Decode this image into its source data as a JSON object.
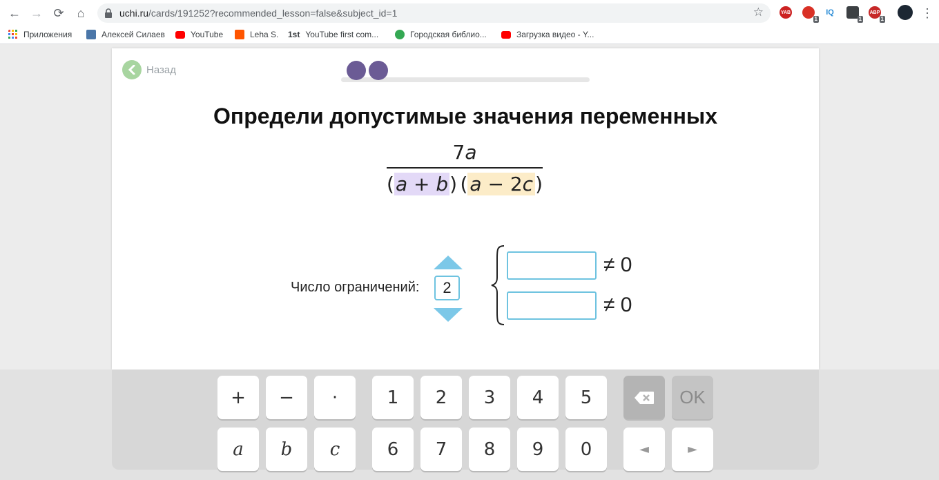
{
  "browser": {
    "url_host": "uchi.ru",
    "url_path": "/cards/191252?recommended_lesson=false&subject_id=1",
    "nav": {
      "back": "←",
      "forward": "→",
      "reload": "⟳",
      "home": "⌂"
    },
    "star": "☆",
    "menu": "⋮",
    "extensions": [
      {
        "label": "YAB",
        "color": "#cc2222",
        "badge": ""
      },
      {
        "label": "",
        "color": "#d93025",
        "badge": "1"
      },
      {
        "label": "IQ",
        "color": "#ffffff",
        "badge": ""
      },
      {
        "label": "",
        "color": "#3c4043",
        "badge": "1"
      },
      {
        "label": "ABP",
        "color": "#c62828",
        "badge": "1"
      }
    ]
  },
  "bookmarks": [
    {
      "label": "Приложения",
      "icon": "apps-grid-icon",
      "color": "#ea4335"
    },
    {
      "label": "Алексей Силаев",
      "icon": "vk-icon",
      "color": "#4a76a8"
    },
    {
      "label": "YouTube",
      "icon": "youtube-icon",
      "color": "#ff0000"
    },
    {
      "label": "Leha S.",
      "icon": "soundcloud-icon",
      "color": "#ff5500"
    },
    {
      "label": "YouTube first com...",
      "icon": "1st-icon",
      "color": "#ffffff",
      "prefix": "1st"
    },
    {
      "label": "Городская библио...",
      "icon": "library-icon",
      "color": "#34a853"
    },
    {
      "label": "Загрузка видео - Y...",
      "icon": "youtube-icon",
      "color": "#ff0000"
    }
  ],
  "page": {
    "back_label": "Назад",
    "progress_steps": 2,
    "title": "Определи допустимые значения переменных",
    "numerator": "7",
    "numerator_var": "a",
    "denominator": {
      "open1": "(",
      "f1_a": "a",
      "f1_op": " + ",
      "f1_b": "b",
      "close1": ")",
      "open2": "(",
      "f2_a": "a",
      "f2_op": " − 2",
      "f2_b": "c",
      "close2": ")"
    },
    "count_label": "Число ограничений:",
    "count_value": "2",
    "conditions": [
      {
        "value": "",
        "suffix": "≠ 0"
      },
      {
        "value": "",
        "suffix": "≠ 0"
      }
    ]
  },
  "keyboard": {
    "row1": [
      "+",
      "−",
      "·",
      "1",
      "2",
      "3",
      "4",
      "5",
      "⌫",
      "OK"
    ],
    "row2": [
      "a",
      "b",
      "c",
      "6",
      "7",
      "8",
      "9",
      "0",
      "◄",
      "►"
    ]
  }
}
